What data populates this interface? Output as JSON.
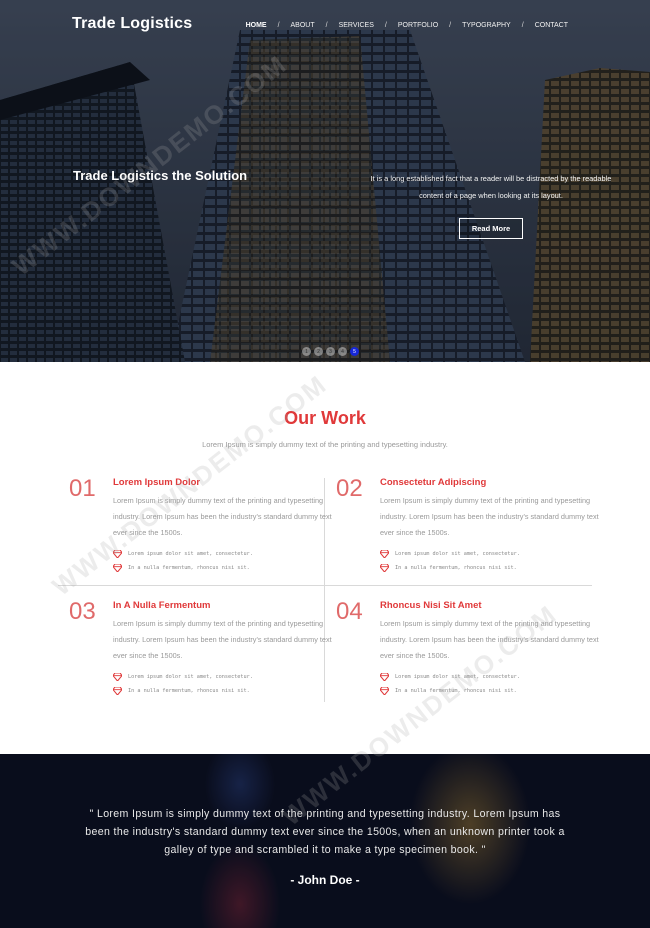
{
  "brand": {
    "name": "Trade Logistics"
  },
  "nav": {
    "items": [
      {
        "label": "HOME"
      },
      {
        "label": "ABOUT"
      },
      {
        "label": "SERVICES"
      },
      {
        "label": "PORTFOLIO"
      },
      {
        "label": "TYPOGRAPHY"
      },
      {
        "label": "CONTACT"
      }
    ],
    "separator": "/"
  },
  "hero": {
    "title": "Trade Logistics the Solution",
    "text": "It is a long established fact that a reader will be distracted by the readable content of a page when looking at its layout.",
    "button": "Read More",
    "slides": [
      "1",
      "2",
      "3",
      "4",
      "5"
    ],
    "active_slide": "5"
  },
  "work": {
    "title": "Our Work",
    "subtitle": "Lorem Ipsum is simply dummy text of the printing and typesetting industry.",
    "cards": [
      {
        "num": "01",
        "title": "Lorem Ipsum Dolor",
        "text": "Lorem Ipsum is simply dummy text of the printing and typesetting industry. Lorem Ipsum has been the industry's standard dummy text ever since the 1500s.",
        "bullets": [
          "Lorem ipsum dolor sit amet, consectetur.",
          "In a nulla fermentum, rhoncus nisi sit."
        ]
      },
      {
        "num": "02",
        "title": "Consectetur Adipiscing",
        "text": "Lorem Ipsum is simply dummy text of the printing and typesetting industry. Lorem Ipsum has been the industry's standard dummy text ever since the 1500s.",
        "bullets": [
          "Lorem ipsum dolor sit amet, consectetur.",
          "In a nulla fermentum, rhoncus nisi sit."
        ]
      },
      {
        "num": "03",
        "title": "In A Nulla Fermentum",
        "text": "Lorem Ipsum is simply dummy text of the printing and typesetting industry. Lorem Ipsum has been the industry's standard dummy text ever since the 1500s.",
        "bullets": [
          "Lorem ipsum dolor sit amet, consectetur.",
          "In a nulla fermentum, rhoncus nisi sit."
        ]
      },
      {
        "num": "04",
        "title": "Rhoncus Nisi Sit Amet",
        "text": "Lorem Ipsum is simply dummy text of the printing and typesetting industry. Lorem Ipsum has been the industry's standard dummy text ever since the 1500s.",
        "bullets": [
          "Lorem ipsum dolor sit amet, consectetur.",
          "In a nulla fermentum, rhoncus nisi sit."
        ]
      }
    ],
    "bullet_icon": "diamond-icon"
  },
  "testimonial": {
    "quote": "\" Lorem Ipsum is simply dummy text of the printing and typesetting industry. Lorem Ipsum has been the industry's standard dummy text ever since the 1500s, when an unknown printer took a galley of type and scrambled it to make a type specimen book. \"",
    "author": "- John Doe -"
  },
  "watermark": "WWW.DOWNDEMO.COM",
  "colors": {
    "accent": "#e0393a",
    "active_dot": "#1627d8"
  }
}
